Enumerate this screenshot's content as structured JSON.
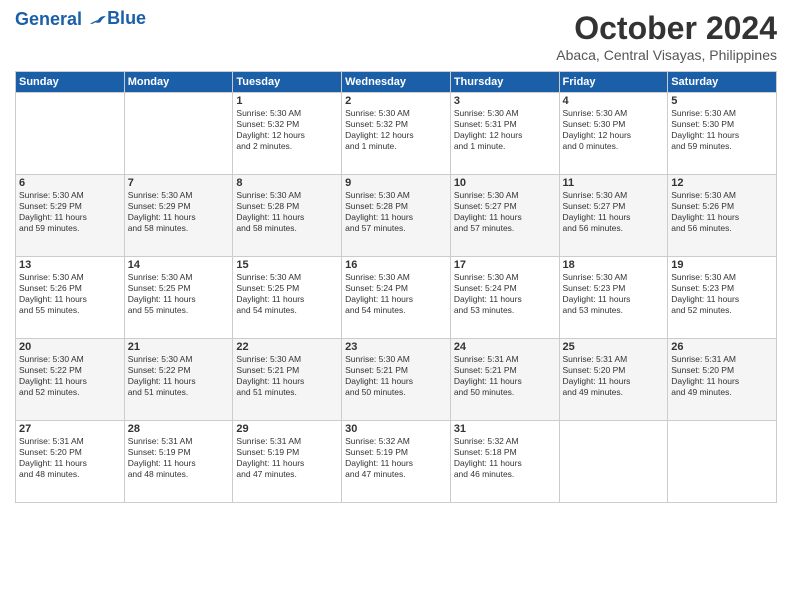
{
  "header": {
    "logo_line1": "General",
    "logo_line2": "Blue",
    "month": "October 2024",
    "location": "Abaca, Central Visayas, Philippines"
  },
  "days_of_week": [
    "Sunday",
    "Monday",
    "Tuesday",
    "Wednesday",
    "Thursday",
    "Friday",
    "Saturday"
  ],
  "weeks": [
    [
      {
        "day": "",
        "text": ""
      },
      {
        "day": "",
        "text": ""
      },
      {
        "day": "1",
        "text": "Sunrise: 5:30 AM\nSunset: 5:32 PM\nDaylight: 12 hours\nand 2 minutes."
      },
      {
        "day": "2",
        "text": "Sunrise: 5:30 AM\nSunset: 5:32 PM\nDaylight: 12 hours\nand 1 minute."
      },
      {
        "day": "3",
        "text": "Sunrise: 5:30 AM\nSunset: 5:31 PM\nDaylight: 12 hours\nand 1 minute."
      },
      {
        "day": "4",
        "text": "Sunrise: 5:30 AM\nSunset: 5:30 PM\nDaylight: 12 hours\nand 0 minutes."
      },
      {
        "day": "5",
        "text": "Sunrise: 5:30 AM\nSunset: 5:30 PM\nDaylight: 11 hours\nand 59 minutes."
      }
    ],
    [
      {
        "day": "6",
        "text": "Sunrise: 5:30 AM\nSunset: 5:29 PM\nDaylight: 11 hours\nand 59 minutes."
      },
      {
        "day": "7",
        "text": "Sunrise: 5:30 AM\nSunset: 5:29 PM\nDaylight: 11 hours\nand 58 minutes."
      },
      {
        "day": "8",
        "text": "Sunrise: 5:30 AM\nSunset: 5:28 PM\nDaylight: 11 hours\nand 58 minutes."
      },
      {
        "day": "9",
        "text": "Sunrise: 5:30 AM\nSunset: 5:28 PM\nDaylight: 11 hours\nand 57 minutes."
      },
      {
        "day": "10",
        "text": "Sunrise: 5:30 AM\nSunset: 5:27 PM\nDaylight: 11 hours\nand 57 minutes."
      },
      {
        "day": "11",
        "text": "Sunrise: 5:30 AM\nSunset: 5:27 PM\nDaylight: 11 hours\nand 56 minutes."
      },
      {
        "day": "12",
        "text": "Sunrise: 5:30 AM\nSunset: 5:26 PM\nDaylight: 11 hours\nand 56 minutes."
      }
    ],
    [
      {
        "day": "13",
        "text": "Sunrise: 5:30 AM\nSunset: 5:26 PM\nDaylight: 11 hours\nand 55 minutes."
      },
      {
        "day": "14",
        "text": "Sunrise: 5:30 AM\nSunset: 5:25 PM\nDaylight: 11 hours\nand 55 minutes."
      },
      {
        "day": "15",
        "text": "Sunrise: 5:30 AM\nSunset: 5:25 PM\nDaylight: 11 hours\nand 54 minutes."
      },
      {
        "day": "16",
        "text": "Sunrise: 5:30 AM\nSunset: 5:24 PM\nDaylight: 11 hours\nand 54 minutes."
      },
      {
        "day": "17",
        "text": "Sunrise: 5:30 AM\nSunset: 5:24 PM\nDaylight: 11 hours\nand 53 minutes."
      },
      {
        "day": "18",
        "text": "Sunrise: 5:30 AM\nSunset: 5:23 PM\nDaylight: 11 hours\nand 53 minutes."
      },
      {
        "day": "19",
        "text": "Sunrise: 5:30 AM\nSunset: 5:23 PM\nDaylight: 11 hours\nand 52 minutes."
      }
    ],
    [
      {
        "day": "20",
        "text": "Sunrise: 5:30 AM\nSunset: 5:22 PM\nDaylight: 11 hours\nand 52 minutes."
      },
      {
        "day": "21",
        "text": "Sunrise: 5:30 AM\nSunset: 5:22 PM\nDaylight: 11 hours\nand 51 minutes."
      },
      {
        "day": "22",
        "text": "Sunrise: 5:30 AM\nSunset: 5:21 PM\nDaylight: 11 hours\nand 51 minutes."
      },
      {
        "day": "23",
        "text": "Sunrise: 5:30 AM\nSunset: 5:21 PM\nDaylight: 11 hours\nand 50 minutes."
      },
      {
        "day": "24",
        "text": "Sunrise: 5:31 AM\nSunset: 5:21 PM\nDaylight: 11 hours\nand 50 minutes."
      },
      {
        "day": "25",
        "text": "Sunrise: 5:31 AM\nSunset: 5:20 PM\nDaylight: 11 hours\nand 49 minutes."
      },
      {
        "day": "26",
        "text": "Sunrise: 5:31 AM\nSunset: 5:20 PM\nDaylight: 11 hours\nand 49 minutes."
      }
    ],
    [
      {
        "day": "27",
        "text": "Sunrise: 5:31 AM\nSunset: 5:20 PM\nDaylight: 11 hours\nand 48 minutes."
      },
      {
        "day": "28",
        "text": "Sunrise: 5:31 AM\nSunset: 5:19 PM\nDaylight: 11 hours\nand 48 minutes."
      },
      {
        "day": "29",
        "text": "Sunrise: 5:31 AM\nSunset: 5:19 PM\nDaylight: 11 hours\nand 47 minutes."
      },
      {
        "day": "30",
        "text": "Sunrise: 5:32 AM\nSunset: 5:19 PM\nDaylight: 11 hours\nand 47 minutes."
      },
      {
        "day": "31",
        "text": "Sunrise: 5:32 AM\nSunset: 5:18 PM\nDaylight: 11 hours\nand 46 minutes."
      },
      {
        "day": "",
        "text": ""
      },
      {
        "day": "",
        "text": ""
      }
    ]
  ]
}
